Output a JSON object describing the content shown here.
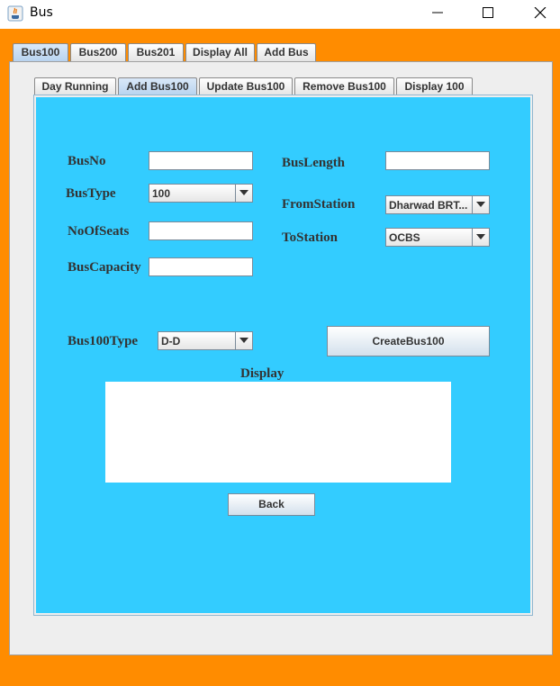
{
  "window": {
    "title": "Bus"
  },
  "top_tabs": [
    "Bus100",
    "Bus200",
    "Bus201",
    "Display All",
    "Add Bus"
  ],
  "sub_tabs": [
    "Day Running",
    "Add Bus100",
    "Update Bus100",
    "Remove Bus100",
    "Display 100"
  ],
  "form": {
    "busno_label": "BusNo",
    "bustype_label": "BusType",
    "bustype_value": "100",
    "noofseats_label": "NoOfSeats",
    "buscapacity_label": "BusCapacity",
    "buslength_label": "BusLength",
    "fromstation_label": "FromStation",
    "fromstation_value": "Dharwad BRT...",
    "tostation_label": "ToStation",
    "tostation_value": "OCBS",
    "bus100type_label": "Bus100Type",
    "bus100type_value": "D-D",
    "create_button": "CreateBus100",
    "display_label": "Display",
    "back_button": "Back"
  },
  "colors": {
    "accent_frame": "#ff8c00",
    "panel_blue": "#33ccff"
  },
  "icons": [
    "java-app-icon",
    "minimize-icon",
    "maximize-icon",
    "close-icon",
    "dropdown-arrow-icon"
  ]
}
